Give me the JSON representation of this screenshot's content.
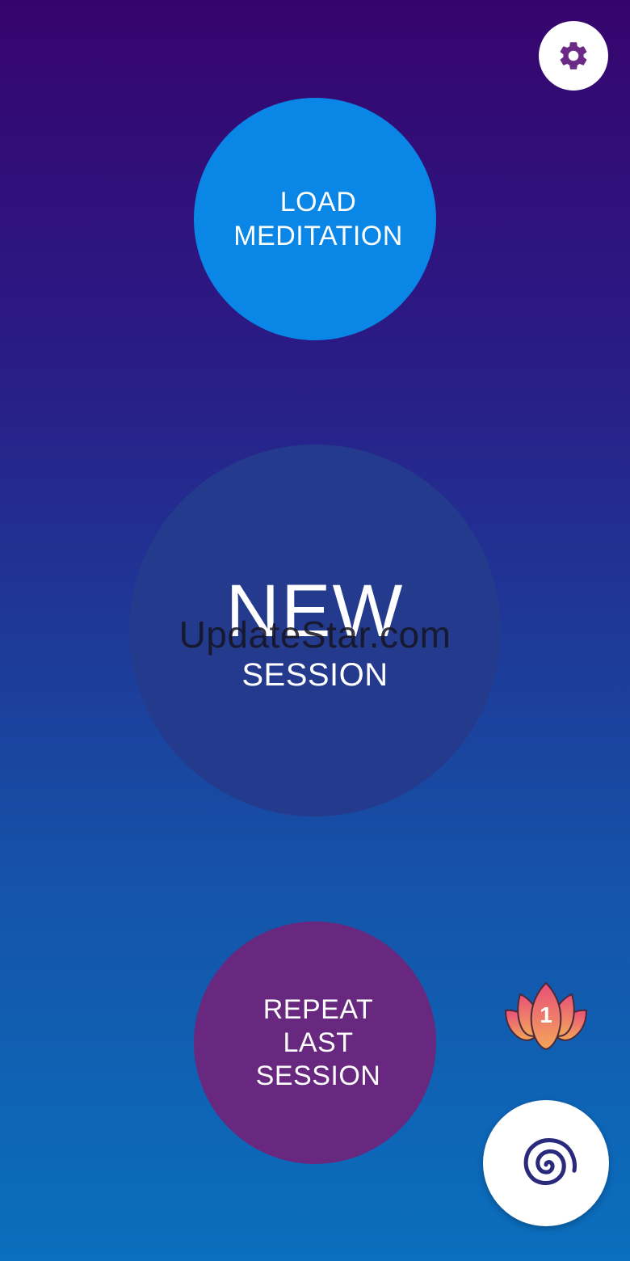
{
  "settings": {
    "icon": "gear-icon"
  },
  "load_button": {
    "lines": [
      "LOAD",
      "MEDITATION"
    ]
  },
  "new_session_button": {
    "line1": "NEW",
    "line2": "SESSION"
  },
  "repeat_button": {
    "lines": [
      "REPEAT",
      "LAST",
      "SESSION"
    ]
  },
  "watermark": "UpdateStar.com",
  "lotus_badge": {
    "icon": "lotus-icon",
    "count": "1"
  },
  "spiral_button": {
    "icon": "spiral-icon"
  },
  "colors": {
    "load": "#0a86e6",
    "new_session": "#243a8c",
    "repeat": "#68287f",
    "gear": "#6a2a86",
    "spiral": "#2a2a7c"
  }
}
